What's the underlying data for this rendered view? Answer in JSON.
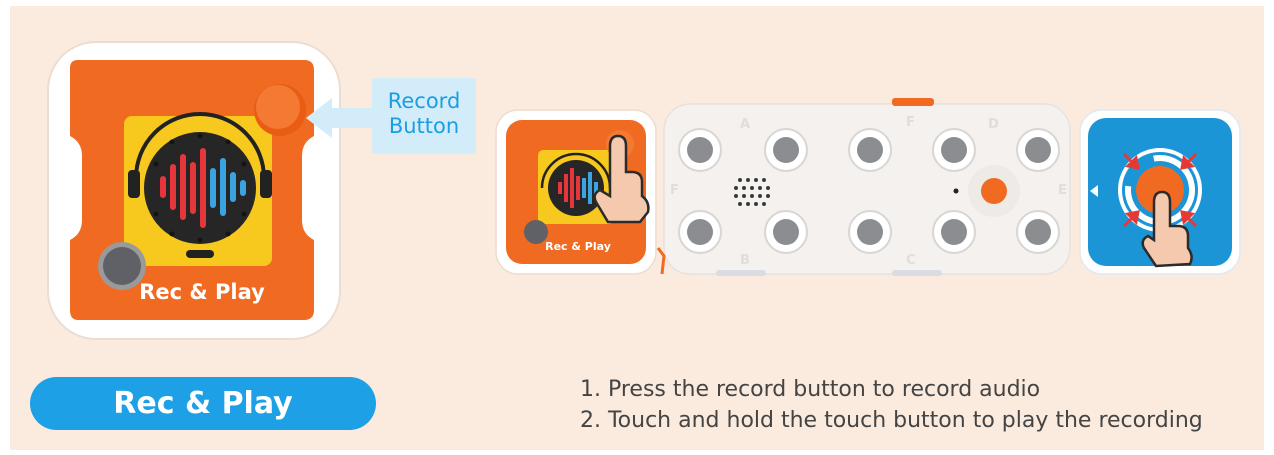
{
  "module": {
    "name": "Rec & Play",
    "label_on_device": "Rec & Play",
    "small_label_on_device": "Rec & Play",
    "callout": [
      "Record",
      "Button"
    ]
  },
  "instructions": [
    "1. Press the record button to record audio",
    "2. Touch and hold the touch button to play the recording"
  ],
  "board_letters": {
    "top_left": "A",
    "top_mid": "F",
    "top_right": "D",
    "left": "F",
    "bottom_left": "B",
    "bottom_mid": "C",
    "right": "E"
  },
  "colors": {
    "background": "#fbebdf",
    "module_orange": "#f06a22",
    "record_button": "#f26b22",
    "face_yellow": "#f7c81d",
    "speaker_dark": "#222222",
    "wave_red": "#e5373b",
    "wave_blue": "#3aa3e0",
    "touch_blue": "#1c95d6",
    "pill_blue": "#1ea0e6",
    "callout_bg": "#d3ecfa",
    "callout_text": "#1a9ee2",
    "hand_skin": "#f4c9ae",
    "arrow_red": "#e53935"
  },
  "icons": [
    "record-button-icon",
    "speaker-icon",
    "touch-hand-icon",
    "pointer-arrow-icon",
    "press-arrows-icon"
  ]
}
